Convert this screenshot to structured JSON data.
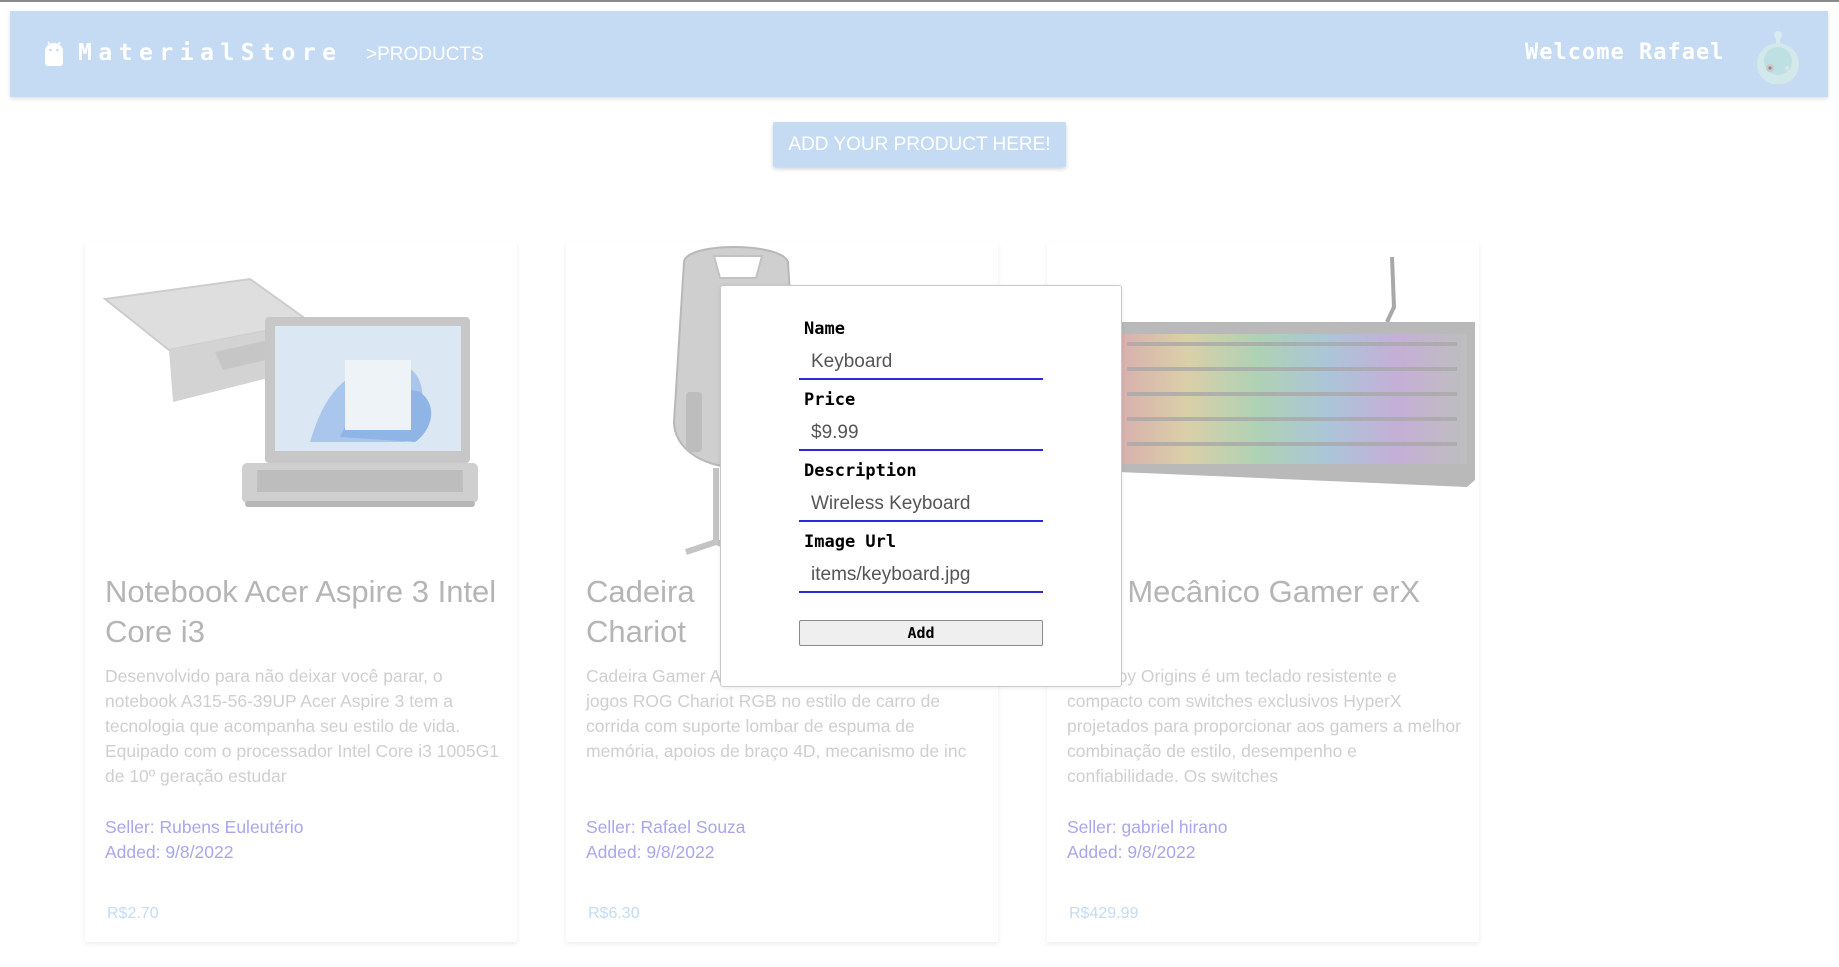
{
  "header": {
    "brand": "MaterialStore",
    "breadcrumb": ">PRODUCTS",
    "welcome": "Welcome Rafael",
    "logo_icon": "android-icon",
    "avatar_icon": "robot-avatar-icon",
    "bar_color": "#c4dbf3"
  },
  "actions": {
    "add_product_label": "ADD YOUR PRODUCT HERE!"
  },
  "products": [
    {
      "title": "Notebook Acer Aspire 3 Intel Core i3",
      "description": "Desenvolvido para não deixar você parar, o notebook A315-56-39UP Acer Aspire 3 tem a tecnologia que acompanha seu estilo de vida. Equipado com o processador Intel Core i3 1005G1 de 10º geração estudar",
      "seller": "Seller: Rubens Eulеutério",
      "added": "Added: 9/8/2022",
      "price": "R$2.70",
      "image": "laptop-image"
    },
    {
      "title": "Cadeira G Chariot",
      "description": "Cadeira Gamer A Braço 4D, Preto Cadeira para jogos ROG Chariot RGB no estilo de carro de corrida com suporte lombar de espuma de memória, apoios de braço 4D, mecanismo de inc",
      "seller": "Seller: Rafael Souza",
      "added": "Added: 9/8/2022",
      "price": "R$6.30",
      "image": "gaming-chair-image"
    },
    {
      "title": "ado Mecânico Gamer erX",
      "description": "erX Alloy Origins é um teclado resistente e compacto com switches exclusivos HyperX projetados para proporcionar aos gamers a melhor combinação de estilo, desempenho e confiabilidade. Os switches",
      "seller": "Seller: gabriel hirano",
      "added": "Added: 9/8/2022",
      "price": "R$429.99",
      "image": "keyboard-image"
    }
  ],
  "modal": {
    "name_label": "Name",
    "name_value": "Keyboard",
    "price_label": "Price",
    "price_value": "$9.99",
    "description_label": "Description",
    "description_value": "Wireless Keyboard",
    "image_label": "Image Url",
    "image_value": "items/keyboard.jpg",
    "submit_label": "Add",
    "underline_color": "#2a2ad8"
  }
}
